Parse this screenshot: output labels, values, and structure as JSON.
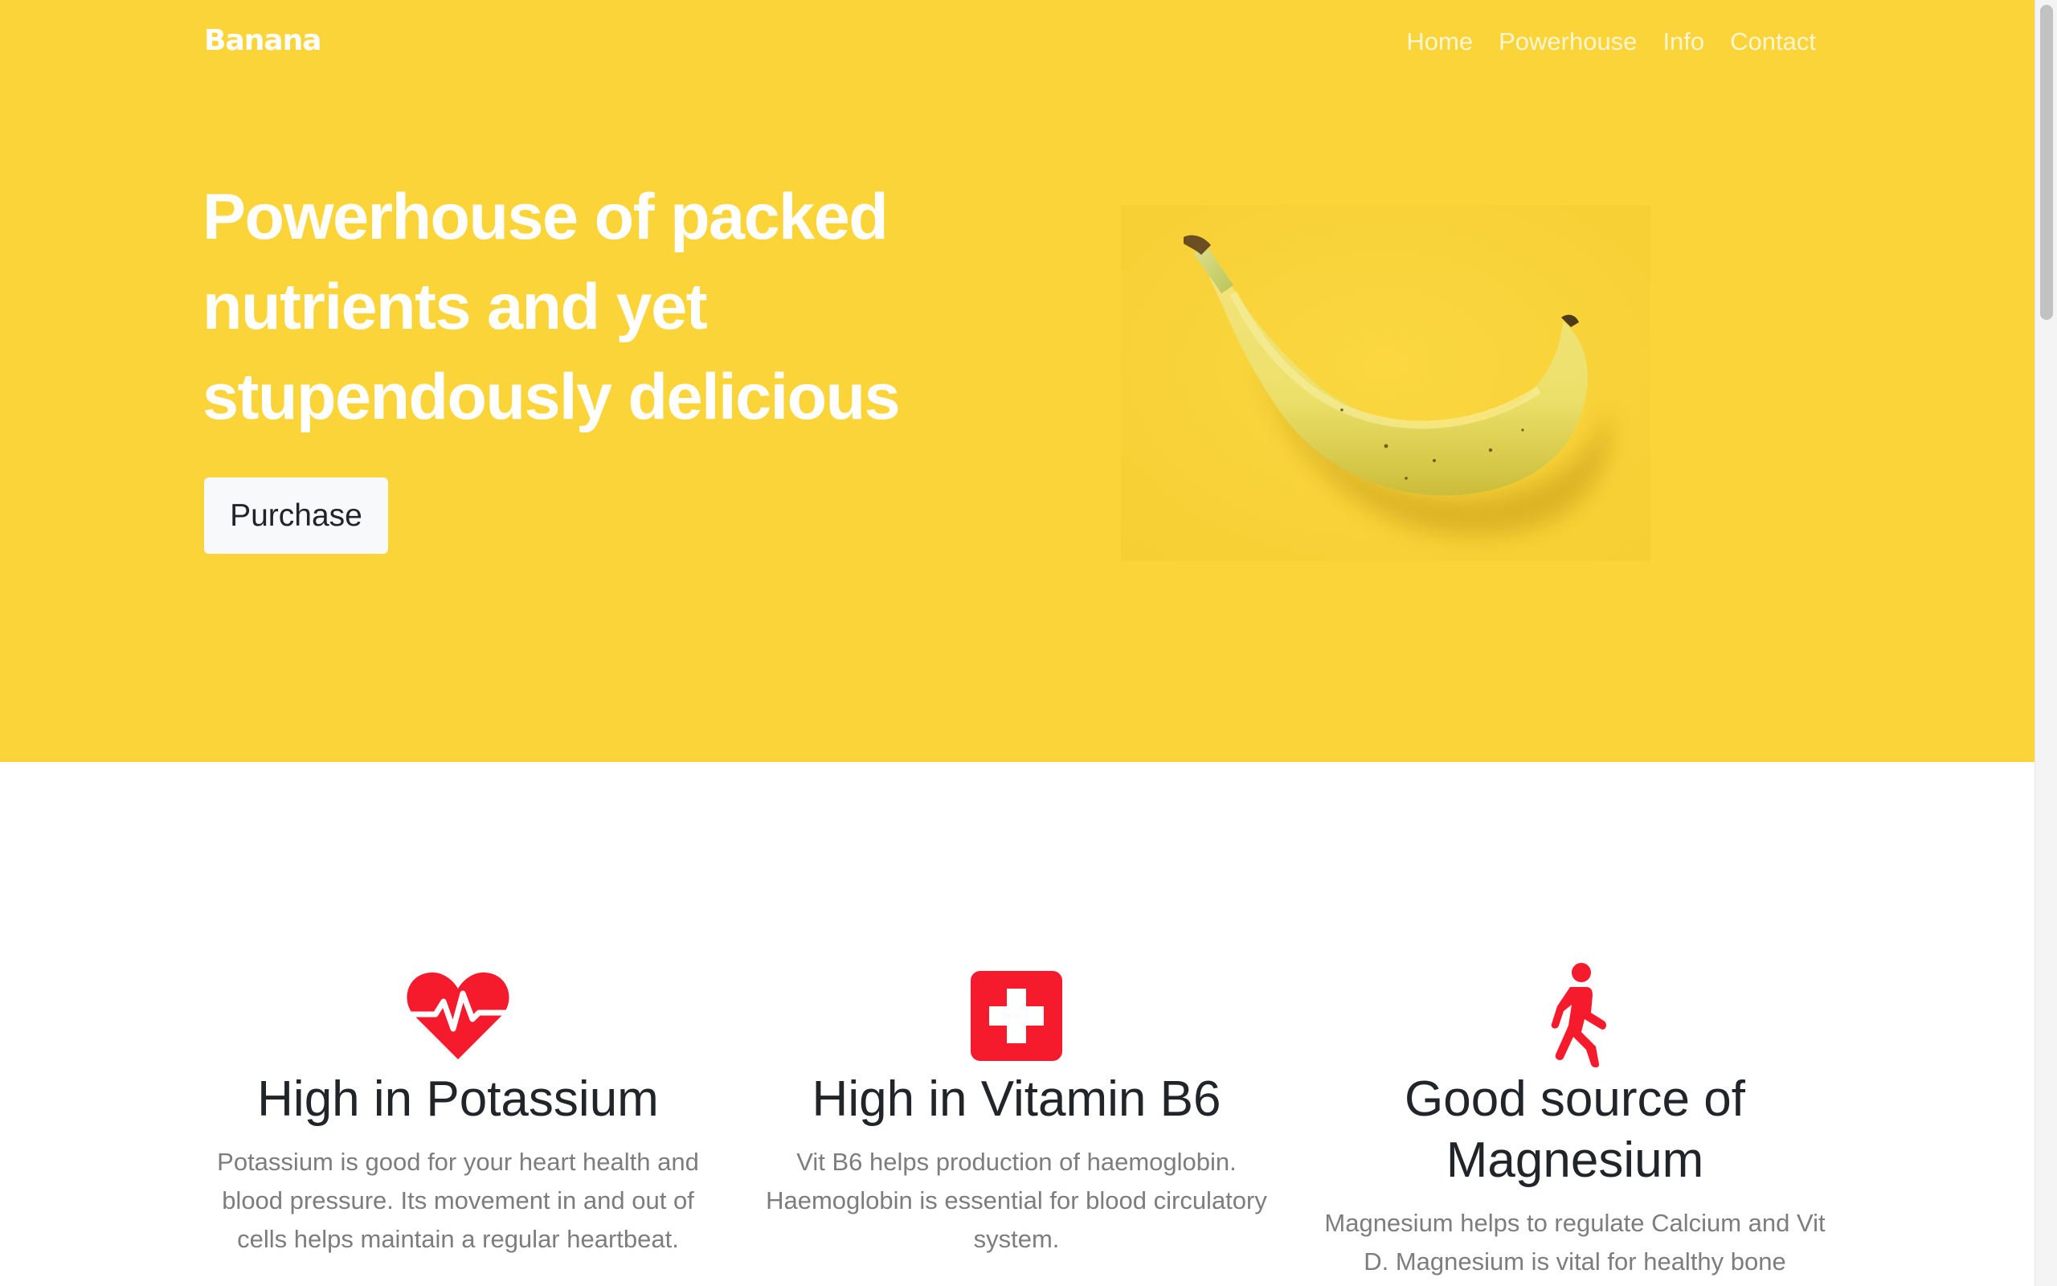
{
  "brand": {
    "name": "Banana"
  },
  "nav": {
    "items": [
      {
        "label": "Home"
      },
      {
        "label": "Powerhouse"
      },
      {
        "label": "Info"
      },
      {
        "label": "Contact"
      }
    ]
  },
  "hero": {
    "headline": "Powerhouse of packed nutrients and yet stupendously delicious",
    "cta_label": "Purchase",
    "image_icon": "banana-photo",
    "background_color": "#fbd43a"
  },
  "features": [
    {
      "icon": "heartbeat-icon",
      "title": "High in Potassium",
      "text": "Potassium is good for your heart health and blood pressure. Its movement in and out of cells helps maintain a regular heartbeat."
    },
    {
      "icon": "medical-cross-icon",
      "title": "High in Vitamin B6",
      "text": "Vit B6 helps production of haemoglobin. Haemoglobin is essential for blood circulatory system."
    },
    {
      "icon": "walking-person-icon",
      "title": "Good source of Magnesium",
      "text": "Magnesium helps to regulate Calcium and Vit D. Magnesium is vital for healthy bone"
    }
  ],
  "colors": {
    "accent": "#fbd43a",
    "icon_red": "#f51a2c",
    "heading": "#212529",
    "muted_text": "#7d7d7d"
  }
}
